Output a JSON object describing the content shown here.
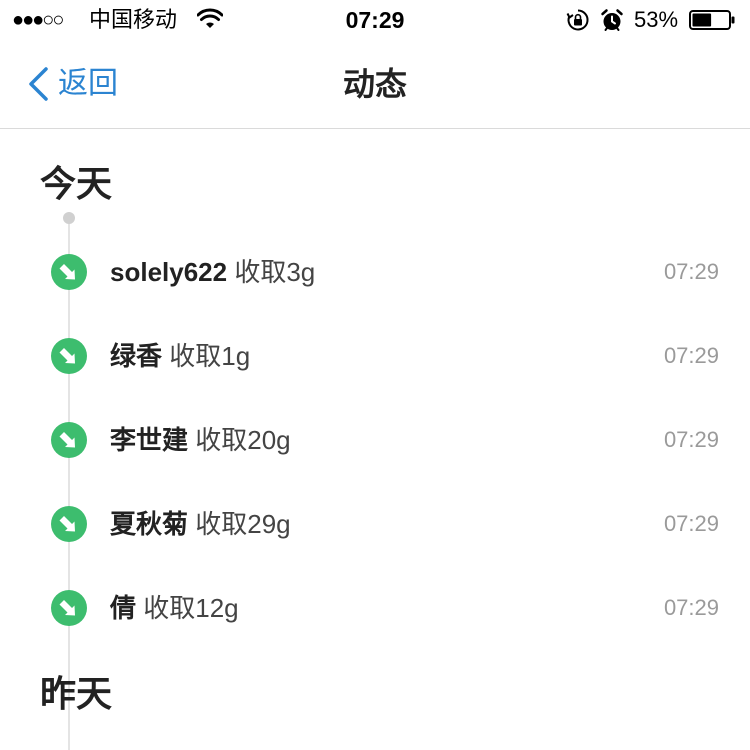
{
  "status_bar": {
    "signal": "●●●○○",
    "carrier": "中国移动",
    "time": "07:29",
    "battery_percent": "53%",
    "battery_level": 0.53,
    "icons": [
      "wifi-icon",
      "rotation-lock-icon",
      "alarm-icon",
      "battery-icon"
    ]
  },
  "nav": {
    "back_label": "返回",
    "title": "动态"
  },
  "colors": {
    "accent_blue": "#2b84d1",
    "feed_icon_green": "#3dbd6e",
    "time_gray": "#9a9a9a"
  },
  "sections": [
    {
      "heading": "今天",
      "items": [
        {
          "name": "solely622",
          "action": "收取3g",
          "time": "07:29"
        },
        {
          "name": "绿香",
          "action": "收取1g",
          "time": "07:29"
        },
        {
          "name": "李世建",
          "action": "收取20g",
          "time": "07:29"
        },
        {
          "name": "夏秋菊",
          "action": "收取29g",
          "time": "07:29"
        },
        {
          "name": "倩",
          "action": "收取12g",
          "time": "07:29"
        }
      ]
    },
    {
      "heading": "昨天",
      "items": []
    }
  ]
}
